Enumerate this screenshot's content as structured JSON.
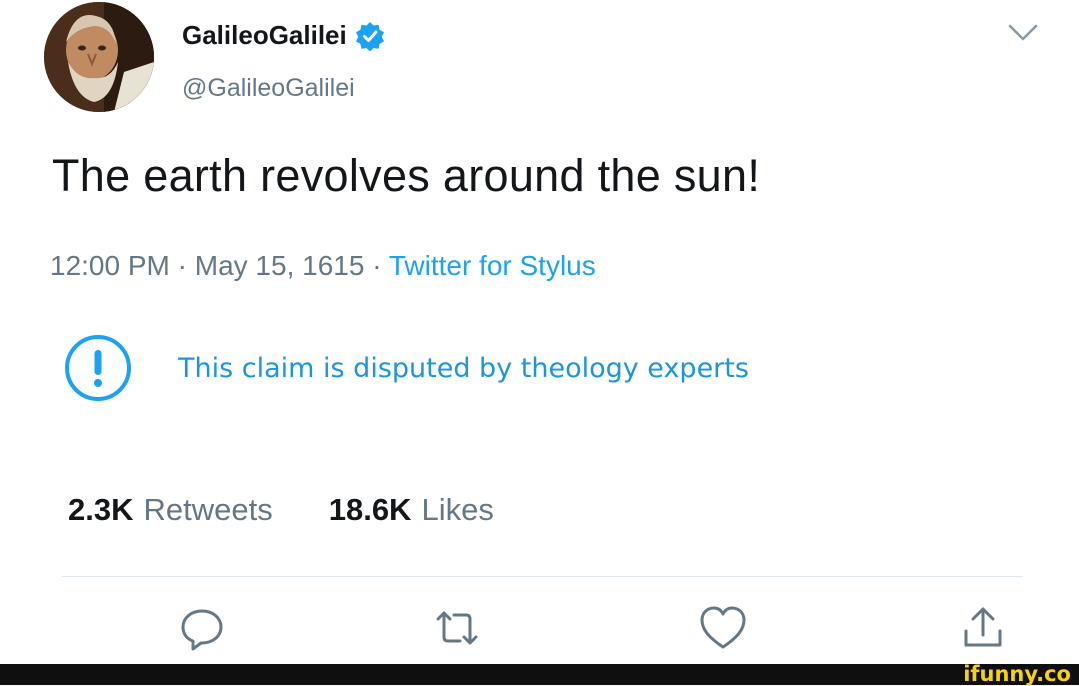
{
  "tweet": {
    "display_name": "GalileoGalilei",
    "handle": "@GalileoGalilei",
    "text": "The earth revolves around the sun!",
    "time": "12:00 PM",
    "date": "May 15, 1615",
    "source": "Twitter for Stylus",
    "separator": " · ",
    "disputed_notice": "This claim is disputed by theology experts"
  },
  "stats": {
    "retweets_count": "2.3K",
    "retweets_label": "Retweets",
    "likes_count": "18.6K",
    "likes_label": "Likes"
  },
  "icons": {
    "verified": "verified-badge-icon",
    "menu": "chevron-down-icon",
    "disputed": "exclamation-circle-icon",
    "reply": "reply-icon",
    "retweet": "retweet-icon",
    "like": "heart-icon",
    "share": "share-icon"
  },
  "colors": {
    "accent": "#1da1f2",
    "text": "#14171a",
    "muted": "#657786",
    "brand": "#f5d20a"
  },
  "watermark": "ifunny.co"
}
